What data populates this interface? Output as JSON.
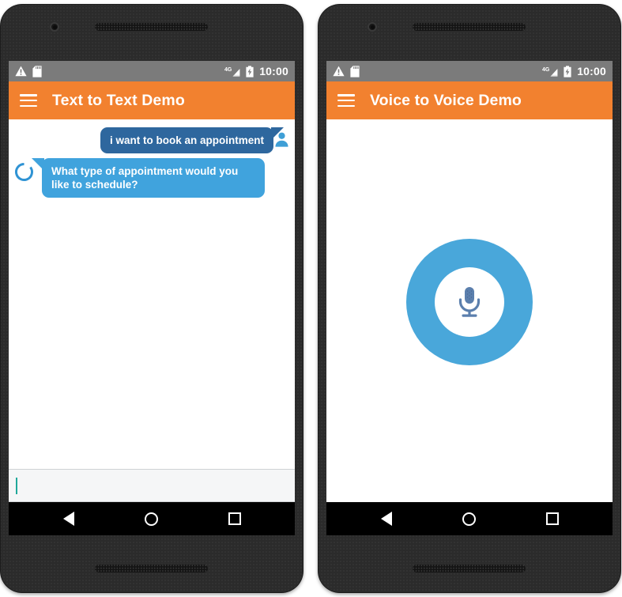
{
  "phones": [
    {
      "id": "text-demo",
      "status_bar": {
        "icons_left": [
          "warning-triangle-icon",
          "sd-card-icon"
        ],
        "network_label": "4G",
        "icons_right": [
          "signal-bars-icon",
          "battery-charging-icon"
        ],
        "time": "10:00"
      },
      "app_bar": {
        "menu_icon": "hamburger-menu-icon",
        "title": "Text to Text Demo"
      },
      "messages": [
        {
          "sender": "user",
          "text": "i want to book an appointment",
          "avatar_icon": "person-avatar-icon",
          "bubble_color": "#2e679e"
        },
        {
          "sender": "bot",
          "text": "What type of appointment would you like to schedule?",
          "avatar_icon": "loading-circle-icon",
          "bubble_color": "#40a3dd"
        }
      ],
      "input": {
        "value": "",
        "placeholder": "",
        "caret_color": "#1fa89a"
      },
      "nav_bar": {
        "back_label": "Back",
        "home_label": "Home",
        "recents_label": "Recents"
      }
    },
    {
      "id": "voice-demo",
      "status_bar": {
        "icons_left": [
          "warning-triangle-icon",
          "sd-card-icon"
        ],
        "network_label": "4G",
        "icons_right": [
          "signal-bars-icon",
          "battery-charging-icon"
        ],
        "time": "10:00"
      },
      "app_bar": {
        "menu_icon": "hamburger-menu-icon",
        "title": "Voice to Voice Demo"
      },
      "voice": {
        "mic_icon": "microphone-icon",
        "ring_color": "#49a7da",
        "inner_color": "#ffffff",
        "mic_color": "#5b7fad"
      },
      "nav_bar": {
        "back_label": "Back",
        "home_label": "Home",
        "recents_label": "Recents"
      }
    }
  ],
  "theme": {
    "app_bar_color": "#f2812f",
    "status_bar_color": "#7b7b7b",
    "chassis_color": "#2b2b2b",
    "nav_bar_color": "#000000"
  }
}
